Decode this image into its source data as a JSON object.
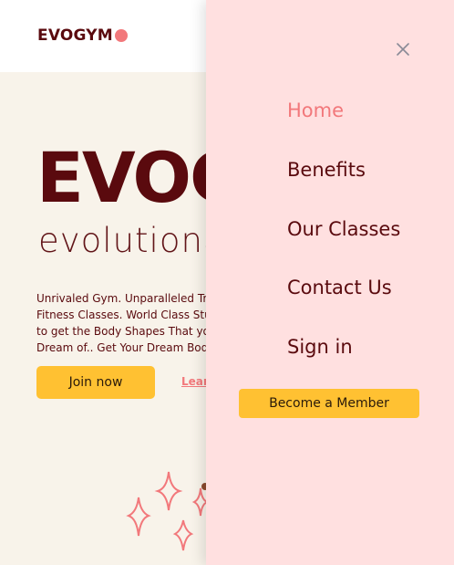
{
  "brand": {
    "logo_text": "EVOGYM",
    "accent": "#f2787b",
    "primary": "#5a0a0e",
    "button": "#ffc132"
  },
  "hero": {
    "title": "EVOGYM",
    "subtitle": "evolutionaryfitness",
    "description": "Unrivaled Gym. Unparalleled Training Fitness Classes. World Class Studios to get the Body Shapes That you Dream of.. Get Your Dream Body Now.",
    "join_label": "Join now",
    "learn_label": "Learn More"
  },
  "drawer": {
    "close_icon": "close-icon",
    "nav": [
      {
        "label": "Home",
        "active": true
      },
      {
        "label": "Benefits",
        "active": false
      },
      {
        "label": "Our Classes",
        "active": false
      },
      {
        "label": "Contact Us",
        "active": false
      },
      {
        "label": "Sign in",
        "active": false
      }
    ],
    "cta_label": "Become a Member"
  }
}
